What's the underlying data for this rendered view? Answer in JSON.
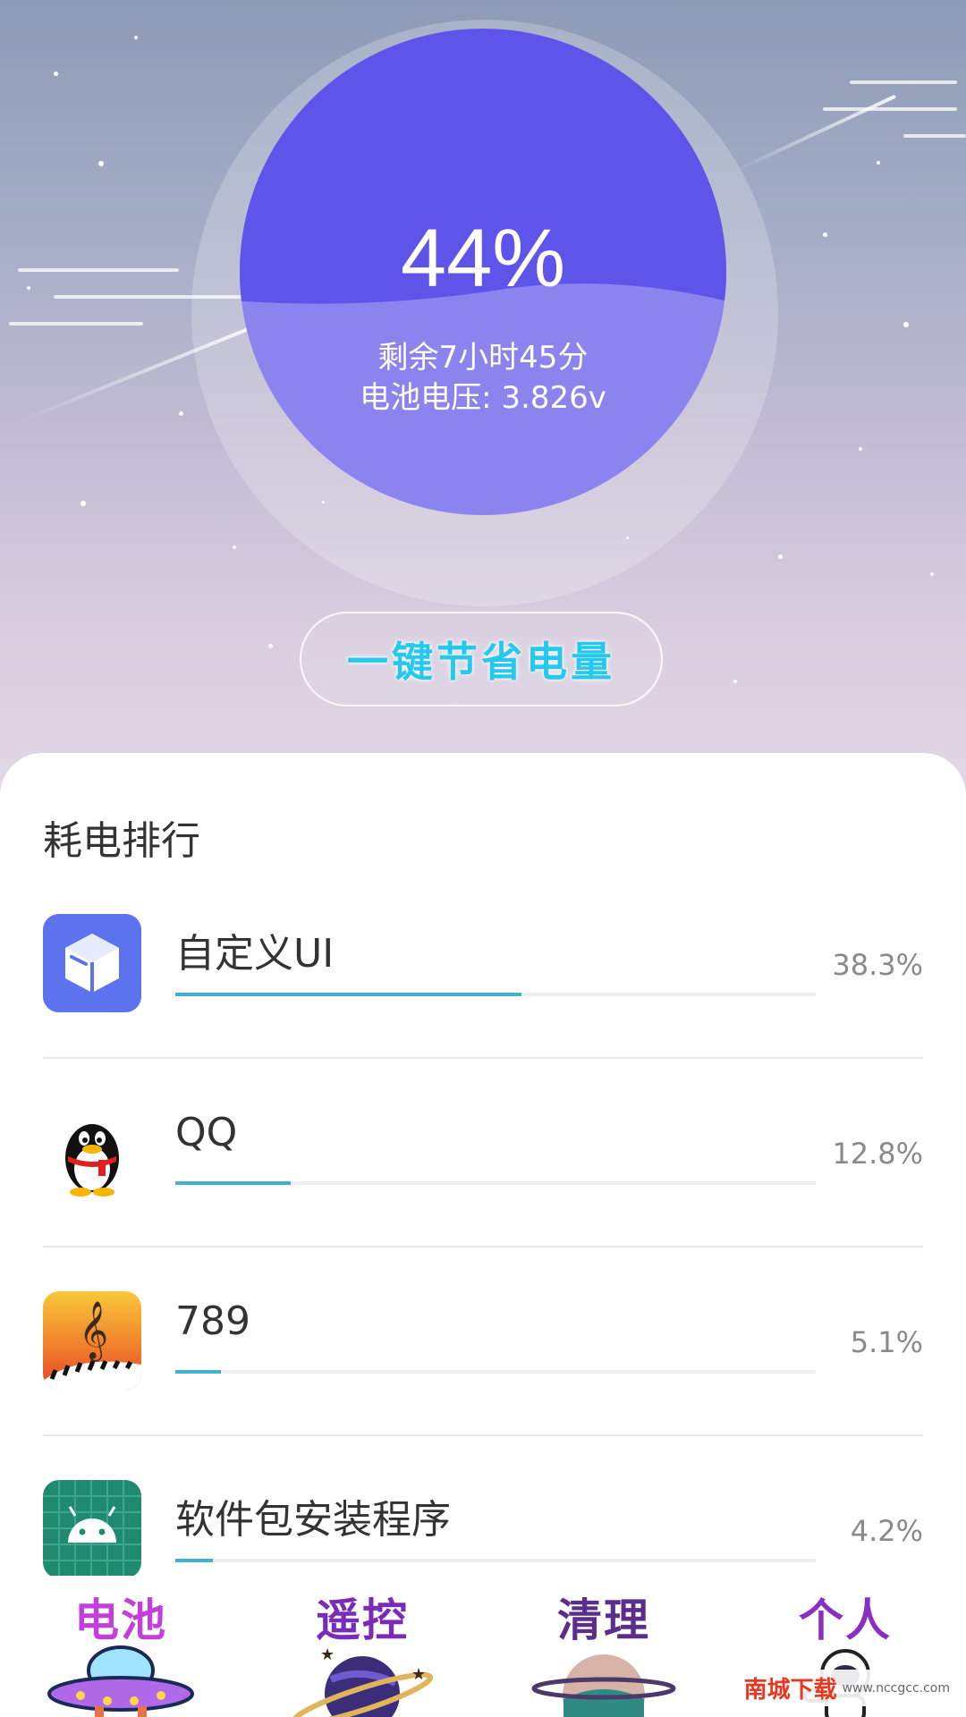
{
  "battery": {
    "percent": "44%",
    "remaining": "剩余7小时45分",
    "voltage": "电池电压: 3.826v",
    "level": 0.44
  },
  "save_button": {
    "label": "一键节省电量",
    "color": "#27c8ee"
  },
  "ranking": {
    "title": "耗电排行",
    "items": [
      {
        "name": "自定义UI",
        "value": "38.3%",
        "fraction": 0.383,
        "icon": "box-app-icon"
      },
      {
        "name": "QQ",
        "value": "12.8%",
        "fraction": 0.128,
        "icon": "qq-penguin-icon"
      },
      {
        "name": "789",
        "value": "5.1%",
        "fraction": 0.051,
        "icon": "music-piano-app-icon"
      },
      {
        "name": "软件包安装程序",
        "value": "4.2%",
        "fraction": 0.042,
        "icon": "android-installer-icon"
      }
    ]
  },
  "nav": {
    "items": [
      {
        "label": "电池",
        "color": "#c23fd9",
        "icon": "ufo-icon"
      },
      {
        "label": "遥控",
        "color": "#7a2bb8",
        "icon": "planet-rings-icon"
      },
      {
        "label": "清理",
        "color": "#5b2e8c",
        "icon": "planet-icon"
      },
      {
        "label": "个人",
        "color": "#8a2ec4",
        "icon": "astronaut-icon"
      }
    ]
  },
  "watermark": {
    "text": "南城下载",
    "url": "www.nccgcc.com"
  },
  "colors": {
    "circle_top": "#5f54ea",
    "circle_bottom": "#8b84ef",
    "bar": "#40b2d0"
  }
}
